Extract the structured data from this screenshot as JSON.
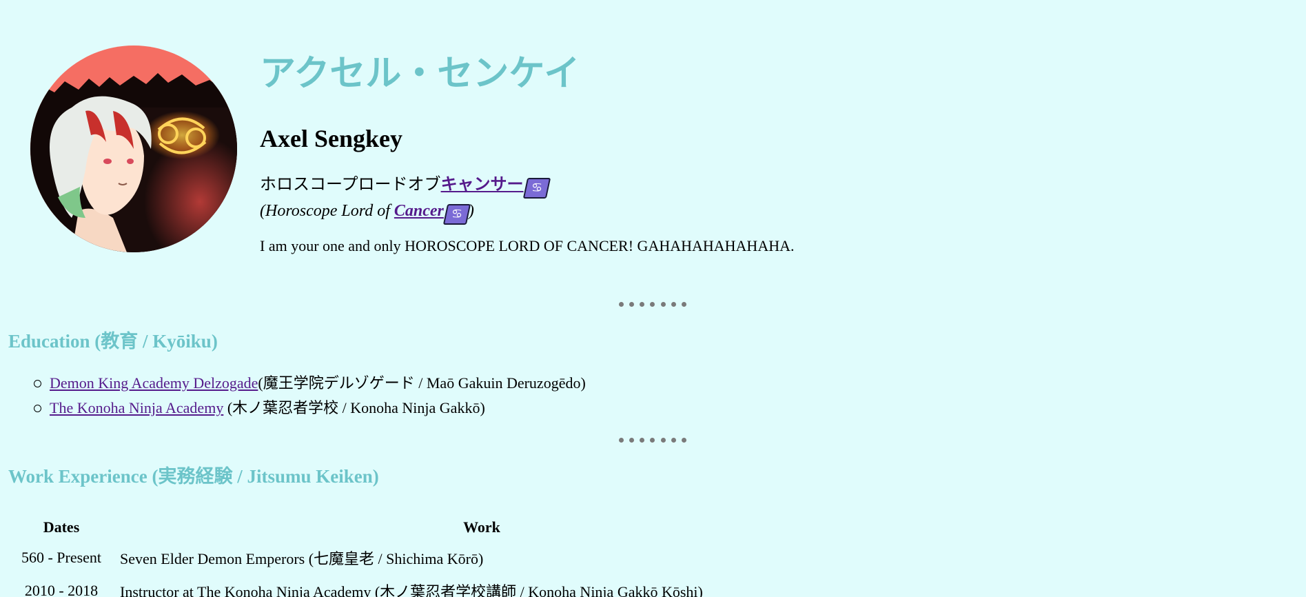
{
  "profile": {
    "name_jp": "アクセル・センケイ",
    "name_en": "Axel Sengkey",
    "title_jp_prefix": "ホロスコープロードオブ",
    "title_jp_link": "キャンサー",
    "title_en_prefix": "(Horoscope Lord of ",
    "title_en_link": "Cancer",
    "title_en_suffix": ")",
    "zodiac_symbol": "♋",
    "bio": "I am your one and only HOROSCOPE LORD OF CANCER! GAHAHAHAHAHAHA."
  },
  "education": {
    "heading_en": "Education (",
    "heading_jp": "教育",
    "heading_rest": " / Kyōiku)",
    "items": [
      {
        "link": "Demon King Academy Delzogade",
        "paren_open": "(",
        "jp": "魔王学院デルゾゲード",
        "romaji": " / Maō Gakuin Deruzogēdo)"
      },
      {
        "link": "The Konoha Ninja Academy",
        "paren_open": " (",
        "jp": "木ノ葉忍者学校",
        "romaji": " / Konoha Ninja Gakkō)"
      }
    ]
  },
  "work": {
    "heading_en": "Work Experience (",
    "heading_jp": "実務経験",
    "heading_rest": " / Jitsumu Keiken)",
    "columns": [
      "Dates",
      "Work"
    ],
    "rows": [
      {
        "dates": "560 - Present",
        "work_en": "Seven Elder Demon Emperors (",
        "work_jp": "七魔皇老",
        "work_rest": " / Shichima Kōrō)"
      },
      {
        "dates": "2010 - 2018",
        "work_en": "Instructor at The Konoha Ninja Academy (",
        "work_jp": "木ノ葉忍者学校講師",
        "work_rest": " / Konoha Ninja Gakkō Kōshi)"
      }
    ]
  },
  "colors": {
    "background": "#e0fcfc",
    "accent": "#6cc4c9",
    "link": "#551a8b",
    "badge": "#7b6bd6",
    "separator": "#7a7a7a"
  },
  "icons": {
    "avatar": "character-portrait-avatar",
    "zodiac": "cancer-zodiac-icon"
  }
}
